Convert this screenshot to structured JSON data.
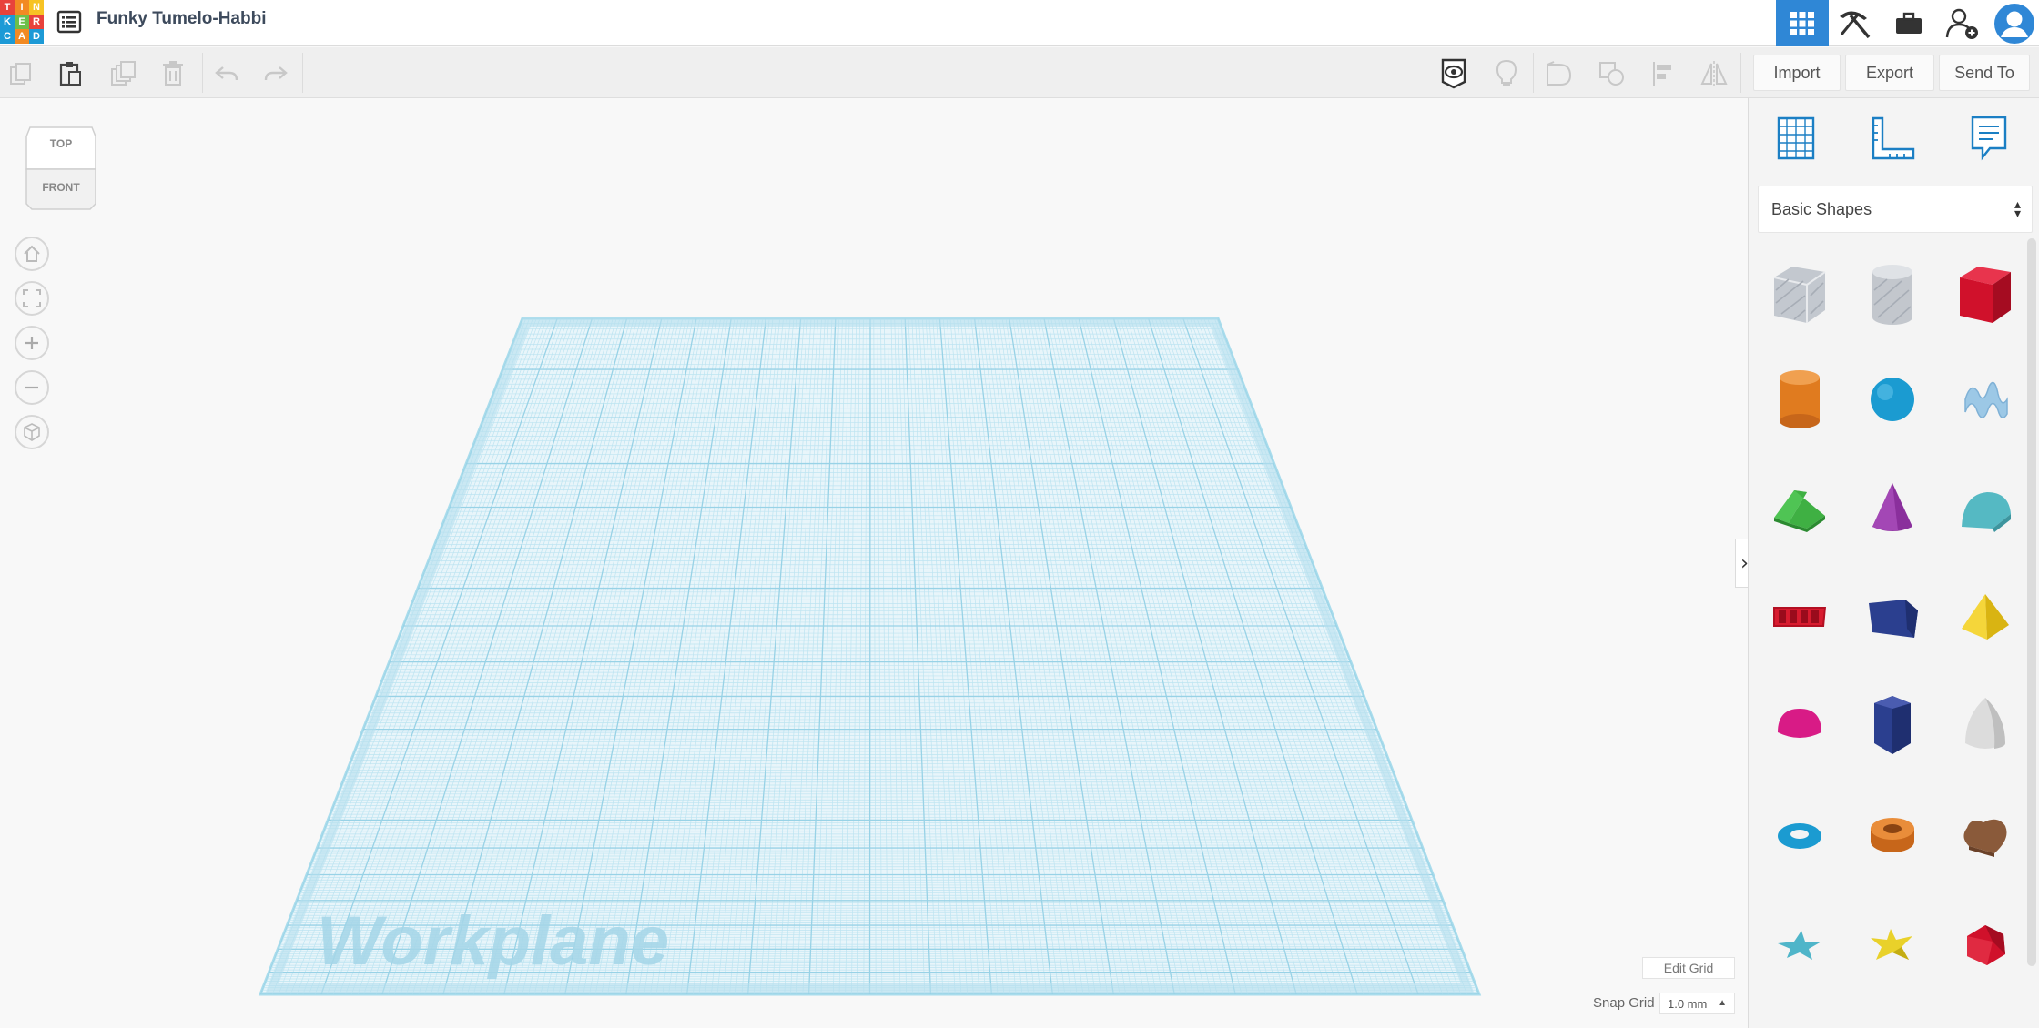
{
  "app": {
    "logo_letters": [
      "T",
      "I",
      "N",
      "K",
      "E",
      "R",
      "C",
      "A",
      "D"
    ],
    "logo_colors": [
      "#e8423b",
      "#f28a23",
      "#f7c324",
      "#1d9ad6",
      "#6dbf4b",
      "#e8423b",
      "#1d9ad6",
      "#f28a23",
      "#1d9ad6"
    ],
    "design_title": "Funky Tumelo-Habbi",
    "accent_color": "#2f87d6"
  },
  "header": {
    "menu_icon": "list-menu-icon",
    "buttons": [
      {
        "name": "3d-design-grid-icon",
        "active": true
      },
      {
        "name": "pickaxe-icon",
        "active": false
      },
      {
        "name": "briefcase-icon",
        "active": false
      },
      {
        "name": "add-user-icon",
        "active": false
      },
      {
        "name": "user-avatar-icon",
        "active": false
      }
    ]
  },
  "toolbar": {
    "left_icons": [
      "copy-icon",
      "paste-icon",
      "duplicate-icon",
      "delete-icon",
      "undo-icon",
      "redo-icon"
    ],
    "right_icons": [
      "show-all-eye-icon",
      "lightbulb-icon",
      "group-icon",
      "ungroup-icon",
      "align-icon",
      "mirror-icon"
    ],
    "import_label": "Import",
    "export_label": "Export",
    "send_to_label": "Send To"
  },
  "viewcube": {
    "top_label": "TOP",
    "front_label": "FRONT"
  },
  "nav_controls": [
    "home-view-icon",
    "fit-all-icon",
    "zoom-in-icon",
    "zoom-out-icon",
    "perspective-icon"
  ],
  "workplane": {
    "label": "Workplane",
    "grid_color": "#8fd0e6"
  },
  "grid_controls": {
    "edit_grid_label": "Edit Grid",
    "snap_grid_label": "Snap Grid",
    "snap_grid_value": "1.0 mm"
  },
  "right_panel": {
    "collapse_icon": "chevron-right-icon",
    "tools": [
      "workplane-tool-icon",
      "ruler-tool-icon",
      "notes-tool-icon"
    ],
    "library_selected": "Basic Shapes",
    "shapes": [
      {
        "name": "box-hole-shape",
        "color": "#b9bec6"
      },
      {
        "name": "cylinder-hole-shape",
        "color": "#c3c7cd"
      },
      {
        "name": "box-shape",
        "color": "#d0112b"
      },
      {
        "name": "cylinder-shape",
        "color": "#e07b1f"
      },
      {
        "name": "sphere-shape",
        "color": "#1b9bd1"
      },
      {
        "name": "scribble-shape",
        "color": "#9cc8e6"
      },
      {
        "name": "roof-shape",
        "color": "#3fb043"
      },
      {
        "name": "cone-shape",
        "color": "#8a2f9c"
      },
      {
        "name": "round-roof-shape",
        "color": "#55b9c3"
      },
      {
        "name": "text-shape",
        "color": "#cc1a2a"
      },
      {
        "name": "wedge-shape",
        "color": "#2b3f8f"
      },
      {
        "name": "pyramid-shape",
        "color": "#f0c419"
      },
      {
        "name": "half-sphere-shape",
        "color": "#d81b86"
      },
      {
        "name": "polygon-shape",
        "color": "#2b3f8f"
      },
      {
        "name": "paraboloid-shape",
        "color": "#d6d6d6"
      },
      {
        "name": "torus-shape",
        "color": "#1b9bd1"
      },
      {
        "name": "tube-shape",
        "color": "#e07b1f"
      },
      {
        "name": "heart-shape",
        "color": "#8a5a3a"
      },
      {
        "name": "star-shape",
        "color": "#4fb5c9"
      },
      {
        "name": "star-yellow-shape",
        "color": "#e9d12a"
      },
      {
        "name": "icosahedron-shape",
        "color": "#d0112b"
      }
    ]
  }
}
